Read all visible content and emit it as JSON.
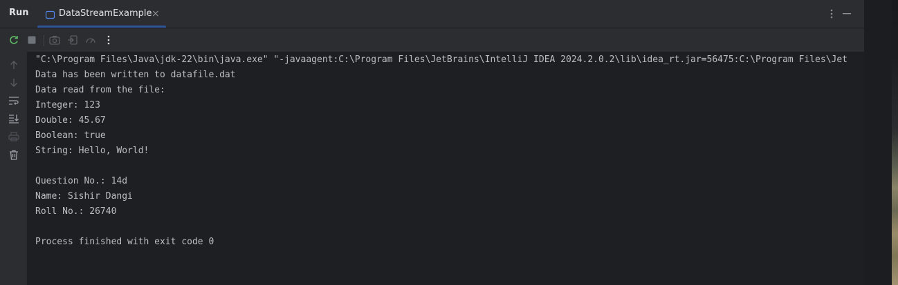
{
  "header": {
    "title": "Run",
    "tab": {
      "label": "DataStreamExample",
      "close": "×"
    }
  },
  "toolbar": {
    "icons": [
      "rerun-icon",
      "stop-icon",
      "screenshot-icon",
      "import-icon",
      "profiler-icon",
      "more-options-icon"
    ]
  },
  "sidebar": {
    "icons": [
      "up-arrow-icon",
      "down-arrow-icon",
      "soft-wrap-icon",
      "scroll-to-end-icon",
      "print-icon",
      "trash-icon"
    ]
  },
  "console": {
    "lines": [
      "\"C:\\Program Files\\Java\\jdk-22\\bin\\java.exe\" \"-javaagent:C:\\Program Files\\JetBrains\\IntelliJ IDEA 2024.2.0.2\\lib\\idea_rt.jar=56475:C:\\Program Files\\Jet",
      "Data has been written to datafile.dat",
      "Data read from the file:",
      "Integer: 123",
      "Double: 45.67",
      "Boolean: true",
      "String: Hello, World!",
      "",
      "Question No.: 14d",
      "Name: Sishir Dangi",
      "Roll No.: 26740",
      "",
      "Process finished with exit code 0"
    ]
  },
  "colors": {
    "panel": "#2b2d30",
    "console_bg": "#1e1f22",
    "text": "#bcbec4",
    "accent": "#3574f0",
    "rerun_green": "#5fb865"
  }
}
